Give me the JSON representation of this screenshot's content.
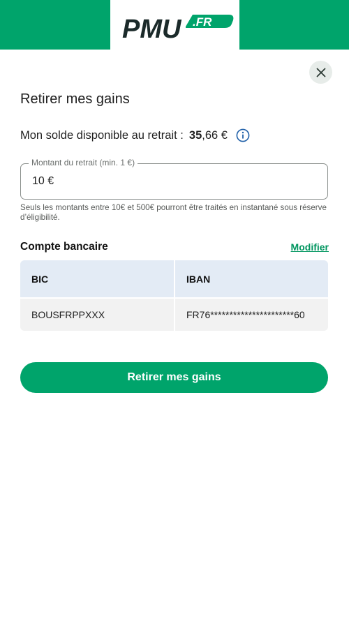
{
  "brand": {
    "logo_text": "PMU",
    "logo_suffix": ".FR",
    "primary_color": "#00a46b",
    "link_color": "#00955f"
  },
  "header": {
    "close_icon": "close-icon"
  },
  "page": {
    "title": "Retirer mes gains"
  },
  "balance": {
    "label": "Mon solde disponible au retrait :",
    "amount_integer": "35",
    "amount_decimal": ",66 €",
    "info_icon": "info-icon"
  },
  "withdrawal": {
    "field_label": "Montant du retrait (min. 1 €)",
    "value": "10 €",
    "helper_text": "Seuls les montants entre 10€ et 500€ pourront être traités en instantané sous réserve d’éligibilité."
  },
  "bank_account": {
    "title": "Compte bancaire",
    "modify_label": "Modifier",
    "columns": [
      "BIC",
      "IBAN"
    ],
    "rows": [
      [
        "BOUSFRPPXXX",
        "FR76**********************60"
      ]
    ]
  },
  "actions": {
    "submit_label": "Retirer mes gains"
  }
}
